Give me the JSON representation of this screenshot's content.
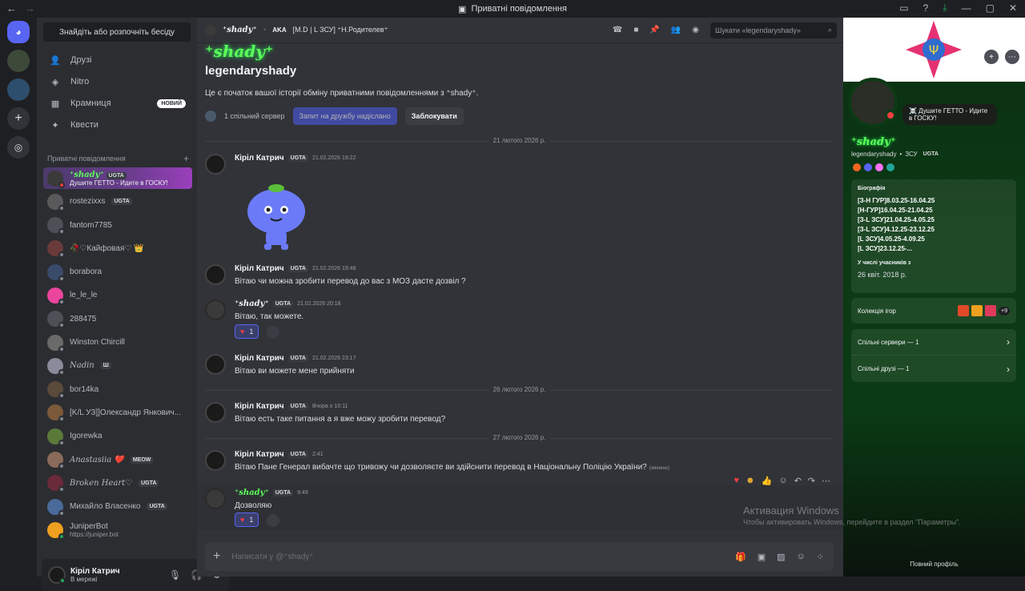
{
  "window": {
    "title": "Приватні повідомлення"
  },
  "sidebar": {
    "search_label": "Знайдіть або розпочніть бесіду",
    "nav": [
      {
        "label": "Друзі"
      },
      {
        "label": "Nitro"
      },
      {
        "label": "Крамниця",
        "badge": "НОВИЙ"
      },
      {
        "label": "Квести"
      }
    ],
    "dm_header": "Приватні повідомлення",
    "dms": [
      {
        "name": "⁺shady⁺",
        "tag": "UGTA",
        "sub": "Душите ГЕТТО - Идите в ГОСКУ!"
      },
      {
        "name": "rostezixxs",
        "tag": "UGTA"
      },
      {
        "name": "fantom7785"
      },
      {
        "name": "🥀♡Кайфовая♡ 👑"
      },
      {
        "name": "borabora"
      },
      {
        "name": "le_le_le"
      },
      {
        "name": "288475"
      },
      {
        "name": "Winston Chircill"
      },
      {
        "name": "Nadin",
        "tag": "Ш"
      },
      {
        "name": "bor14ka"
      },
      {
        "name": "[K/L УЗ]]Олександр Янкович..."
      },
      {
        "name": "Igorewka"
      },
      {
        "name": "Anastasiia ❤️",
        "tag": "MEOW"
      },
      {
        "name": "Broken Heart♡",
        "tag": "UGTA"
      },
      {
        "name": "Михайло Власенко",
        "tag": "UGTA"
      },
      {
        "name": "JuniperBot",
        "sub": "https://juniper.bot"
      }
    ],
    "user": {
      "name": "Кіріл Катрич",
      "status": "В мережі"
    }
  },
  "topbar": {
    "user": "⁺shady⁺",
    "aka": "AKA",
    "server": "[M.D | L ЗСУ] ⁺Н.Родителев⁺",
    "search_placeholder": "Шукати «legendaryshady»"
  },
  "intro": {
    "display_name": "⁺shady⁺",
    "username": "legendaryshady",
    "text": "Це є початок вашої історії обміну приватними повідомленнями з ⁺shady⁺.",
    "mutual": "1 спільний сервер",
    "pending": "Запит на дружбу надіслано",
    "block": "Заблокувати"
  },
  "dividers": [
    "21 лютого 2026 р.",
    "26 лютого 2026 р.",
    "27 лютого 2026 р."
  ],
  "messages": [
    {
      "author": "Кіріл Катрич",
      "tag": "UGTA",
      "time": "21.02.2026 19:22",
      "text": ""
    },
    {
      "author": "Кіріл Катрич",
      "tag": "UGTA",
      "time": "21.02.2026 19:48",
      "text": "Вітаю чи можна зробити перевод до вас з МОЗ дасте дозвіл ?"
    },
    {
      "author": "⁺shady⁺",
      "tag": "UGTA",
      "time": "21.02.2026 20:18",
      "text": "Вітаю, так можете.",
      "reaction": "1"
    },
    {
      "author": "Кіріл Катрич",
      "tag": "UGTA",
      "time": "21.02.2026 23:17",
      "text": "Вітаю ви можете мене прийняти"
    },
    {
      "author": "Кіріл Катрич",
      "tag": "UGTA",
      "time": "Вчора о 10:11",
      "text": "Вітаю есть таке питання а я вже можу зробити перевод?"
    },
    {
      "author": "Кіріл Катрич",
      "tag": "UGTA",
      "time": "2:41",
      "text": "Вітаю Пане Генерал вибачте що тривожу чи дозволяєте ви здійснити перевод в Національну Поліцію України?",
      "edited": "(змінено)"
    },
    {
      "author": "⁺shady⁺",
      "tag": "UGTA",
      "time": "9:49",
      "text": "Дозволяю",
      "reaction": "1"
    }
  ],
  "composer": {
    "placeholder": "Написати у @⁺shady⁺"
  },
  "watermark": {
    "line1": "Активация Windows",
    "line2": "Чтобы активировать Windows, перейдите в раздел \"Параметры\"."
  },
  "profile": {
    "status": "☠️ Душите ГЕТТО - Идите в ГОСКУ!",
    "display_name": "⁺shady⁺",
    "username": "legendaryshady",
    "server_tag": "ЗСУ",
    "tag": "UGTA",
    "bio_title": "Біографія",
    "bio": [
      "[З-Н ГУР]8.03.25-16.04.25",
      "[Н-ГУР]16.04.25-21.04.25",
      "[З-L ЗСУ]21.04.25-4.05.25",
      "[З-L ЗСУ]4.12.25-23.12.25",
      "[L ЗСУ]4.05.25-4.09.25",
      "[L ЗСУ]23.12.25-..."
    ],
    "member_since_title": "У числі учасників з",
    "member_since": "26 квіт. 2018 р.",
    "games_label": "Колекція ігор",
    "games_more": "+9",
    "mutual_servers": "Спільні сервери — 1",
    "mutual_friends": "Спільні друзі — 1",
    "full_profile": "Повний профіль"
  }
}
